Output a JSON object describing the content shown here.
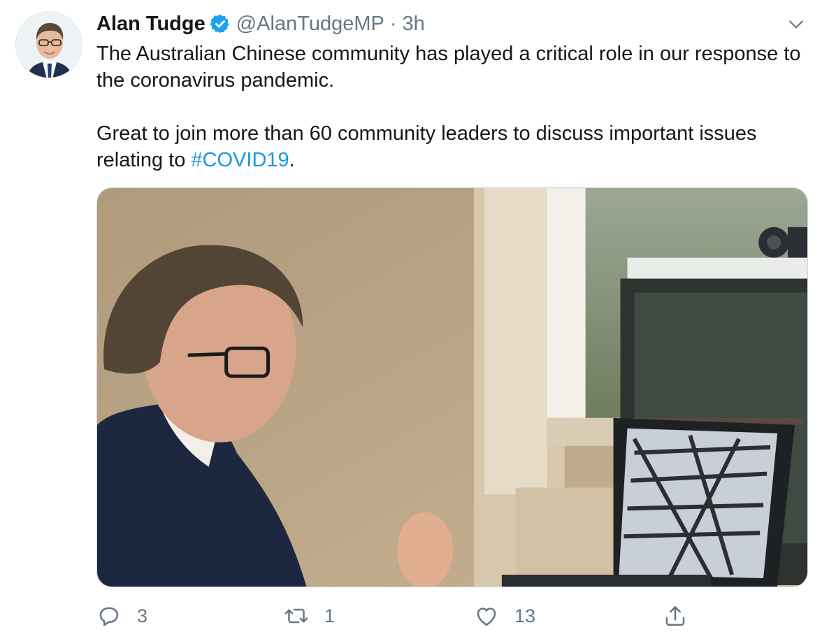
{
  "tweet": {
    "author_name": "Alan Tudge",
    "handle": "@AlanTudgeMP",
    "separator": "·",
    "time": "3h",
    "text_line1": "The Australian Chinese community has played a critical role in our response to the coronavirus pandemic.",
    "text_line2_prefix": "Great to join more than 60 community leaders to discuss important issues relating to ",
    "hashtag": "#COVID19",
    "text_line2_suffix": "."
  },
  "actions": {
    "reply_count": "3",
    "retweet_count": "1",
    "like_count": "13"
  },
  "icons": {
    "verified": "verified-badge-icon",
    "caret": "chevron-down-icon",
    "reply": "reply-icon",
    "retweet": "retweet-icon",
    "like": "heart-icon",
    "share": "share-icon"
  },
  "colors": {
    "text": "#14171a",
    "secondary": "#657786",
    "link": "#1b95e0",
    "verified": "#1da1f2"
  }
}
